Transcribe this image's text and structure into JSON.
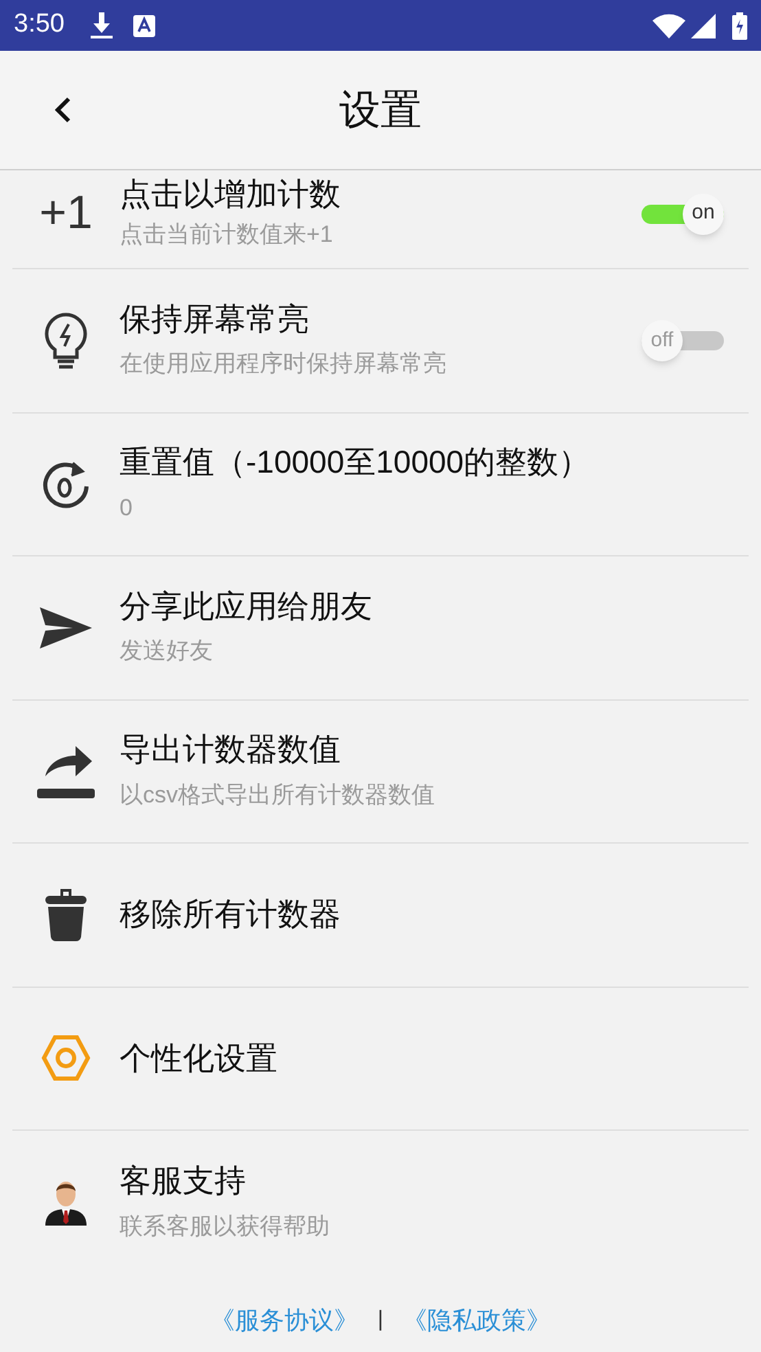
{
  "status_bar": {
    "time": "3:50"
  },
  "header": {
    "title": "设置"
  },
  "settings": [
    {
      "kind": "toggle",
      "icon_text": "+1",
      "title": "点击以增加计数",
      "subtitle": "点击当前计数值来+1",
      "on": true,
      "switch_label": "on"
    },
    {
      "kind": "toggle",
      "title": "保持屏幕常亮",
      "subtitle": "在使用应用程序时保持屏幕常亮",
      "on": false,
      "switch_label": "off"
    },
    {
      "kind": "action",
      "title": "重置值（-10000至10000的整数）",
      "subtitle": "0"
    },
    {
      "kind": "action",
      "title": "分享此应用给朋友",
      "subtitle": "发送好友"
    },
    {
      "kind": "action",
      "title": "导出计数器数值",
      "subtitle": "以csv格式导出所有计数器数值"
    },
    {
      "kind": "action",
      "title": "移除所有计数器"
    },
    {
      "kind": "action",
      "title": "个性化设置"
    },
    {
      "kind": "action",
      "title": "客服支持",
      "subtitle": "联系客服以获得帮助"
    }
  ],
  "footer": {
    "links": [
      "《服务协议》",
      "《隐私政策》"
    ],
    "separator": "|"
  }
}
